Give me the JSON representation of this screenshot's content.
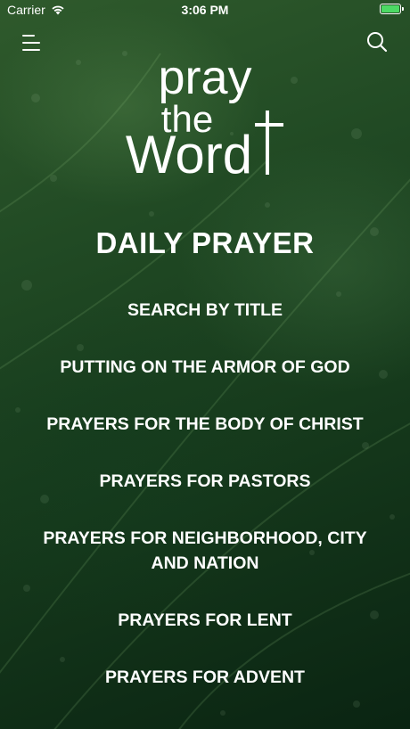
{
  "status_bar": {
    "carrier": "Carrier",
    "time": "3:06 PM",
    "battery_level": 1.0,
    "battery_color": "#4cd964"
  },
  "nav": {
    "menu_icon": "hamburger-menu-icon",
    "search_icon": "search-icon"
  },
  "logo": {
    "line1": "pray",
    "line2": "the",
    "line3": "Word"
  },
  "heading": "DAILY PRAYER",
  "menu_items": [
    {
      "label": "SEARCH BY TITLE"
    },
    {
      "label": "PUTTING ON THE ARMOR OF GOD"
    },
    {
      "label": "PRAYERS FOR THE BODY OF CHRIST"
    },
    {
      "label": "PRAYERS FOR PASTORS"
    },
    {
      "label": "PRAYERS FOR NEIGHBORHOOD, CITY AND NATION"
    },
    {
      "label": "PRAYERS FOR LENT"
    },
    {
      "label": "PRAYERS FOR ADVENT"
    }
  ]
}
